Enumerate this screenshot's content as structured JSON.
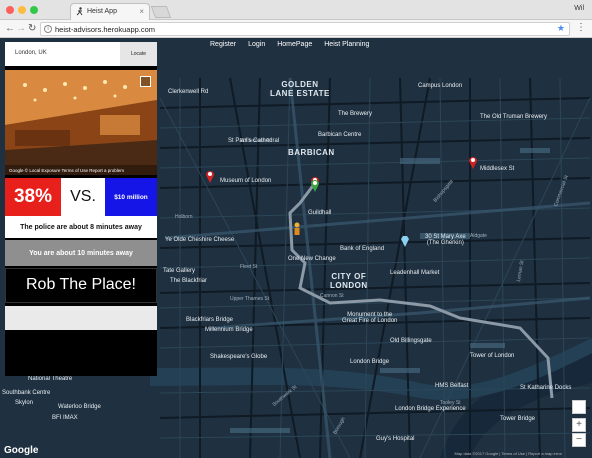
{
  "browser": {
    "tab_title": "Heist App",
    "user_label": "Wil",
    "url": "heist-advisors.herokuapp.com"
  },
  "nav": {
    "items": [
      "Register",
      "Login",
      "HomePage",
      "Heist Planning"
    ]
  },
  "panel": {
    "search_value": "London, UK",
    "locate_label": "Locate",
    "streetview_footer": "© Local Exposure   Terms of Use   Report a problem",
    "streetview_logo": "Google",
    "percent": "38%",
    "vs_label": "VS.",
    "money": "$10 million",
    "police_text": "The police are about 8 minutes away",
    "you_text": "You are about 10 minutes away",
    "action_label": "Rob The Place!"
  },
  "map": {
    "labels": [
      {
        "t": "GOLDEN\nLANE ESTATE",
        "big": true
      },
      {
        "t": "BARBICAN",
        "big": true
      },
      {
        "t": "CITY OF\nLONDON",
        "big": true
      },
      {
        "t": "Clerkenwell Rd"
      },
      {
        "t": "Campus London"
      },
      {
        "t": "The Brewery"
      },
      {
        "t": "Barbican Centre"
      },
      {
        "t": "Whitecross St"
      },
      {
        "t": "Museum of London"
      },
      {
        "t": "St Paul's Cathedral"
      },
      {
        "t": "Guildhall"
      },
      {
        "t": "Bank of England"
      },
      {
        "t": "One New Change"
      },
      {
        "t": "Leadenhall Market"
      },
      {
        "t": "30 St Mary Axe\n(The Gherkin)"
      },
      {
        "t": "The Old Truman Brewery"
      },
      {
        "t": "Middlesex St"
      },
      {
        "t": "Ye Olde Cheshire Cheese"
      },
      {
        "t": "Tate Gallery"
      },
      {
        "t": "The Blackfriar"
      },
      {
        "t": "Blackfriars Bridge"
      },
      {
        "t": "Millennium Bridge"
      },
      {
        "t": "Shakespeare's Globe"
      },
      {
        "t": "Monument to the\nGreat Fire of London"
      },
      {
        "t": "Old Billingsgate"
      },
      {
        "t": "Tower of London"
      },
      {
        "t": "London Bridge"
      },
      {
        "t": "HMS Belfast"
      },
      {
        "t": "St Katharine Docks"
      },
      {
        "t": "Tower Bridge"
      },
      {
        "t": "London Bridge Experience"
      },
      {
        "t": "Guy's Hospital"
      },
      {
        "t": "National Theatre"
      },
      {
        "t": "Southbank Centre"
      },
      {
        "t": "Waterloo Bridge"
      },
      {
        "t": "BFI IMAX"
      },
      {
        "t": "Skylon"
      },
      {
        "t": "Upper Thames St"
      },
      {
        "t": "Cannon St"
      },
      {
        "t": "Commercial St"
      },
      {
        "t": "Leman St"
      },
      {
        "t": "Holborn"
      },
      {
        "t": "Fleet St"
      },
      {
        "t": "Southwark St"
      },
      {
        "t": "Bishopsgate"
      },
      {
        "t": "Aldgate"
      },
      {
        "t": "Borough"
      },
      {
        "t": "Tooley St"
      }
    ],
    "attribution": "Map data ©2017 Google | Terms of Use | Report a map error",
    "logo": "Google",
    "zoom_in": "+",
    "zoom_out": "−"
  },
  "colors": {
    "percent_bg": "#e8201c",
    "money_bg": "#1415e6",
    "map_bg": "#1e2f3f",
    "route": "#8c99a6"
  }
}
